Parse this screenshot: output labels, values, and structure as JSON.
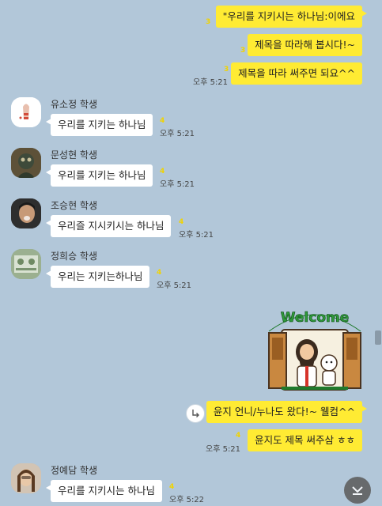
{
  "outgoing": [
    {
      "text": "\"우리를 지키시는 하나님:이에요",
      "unread": "3",
      "time": ""
    },
    {
      "text": "제목을 따라해 봅시다!~",
      "unread": "3",
      "time": ""
    },
    {
      "text": "제목을 따라 써주면 되요^^",
      "unread": "3",
      "time": "오후 5:21"
    },
    {
      "text": "윤지 언니/누나도 왔다!~ 웰컴^^",
      "unread": "",
      "time": ""
    },
    {
      "text": "윤지도 제목 써주삼 ㅎㅎ",
      "unread": "4",
      "time": "오후 5:21"
    }
  ],
  "incoming": [
    {
      "name": "유소정 학생",
      "text": "우리를 지키는 하나님",
      "unread": "4",
      "time": "오후 5:21"
    },
    {
      "name": "문성현 학생",
      "text": "우리를 지키는 하나님",
      "unread": "4",
      "time": "오후 5:21"
    },
    {
      "name": "조승현 학생",
      "text": "우리즐 지시키시는 하나님",
      "unread": "4",
      "time": "오후 5:21"
    },
    {
      "name": "정희승 학생",
      "text": "우리는 지키는하나님",
      "unread": "4",
      "time": "오후 5:21"
    },
    {
      "name": "정예담 학생",
      "text": "우리를 지키시는 하나님",
      "unread": "4",
      "time": "오후 5:22"
    }
  ],
  "sticker": {
    "text": "Welcome"
  },
  "colors": {
    "background": "#b2c7d9",
    "outgoing_bubble": "#ffeb33",
    "incoming_bubble": "#ffffff"
  },
  "icons": {
    "share": "share-arrow-icon",
    "scroll_down": "chevron-down-icon"
  }
}
